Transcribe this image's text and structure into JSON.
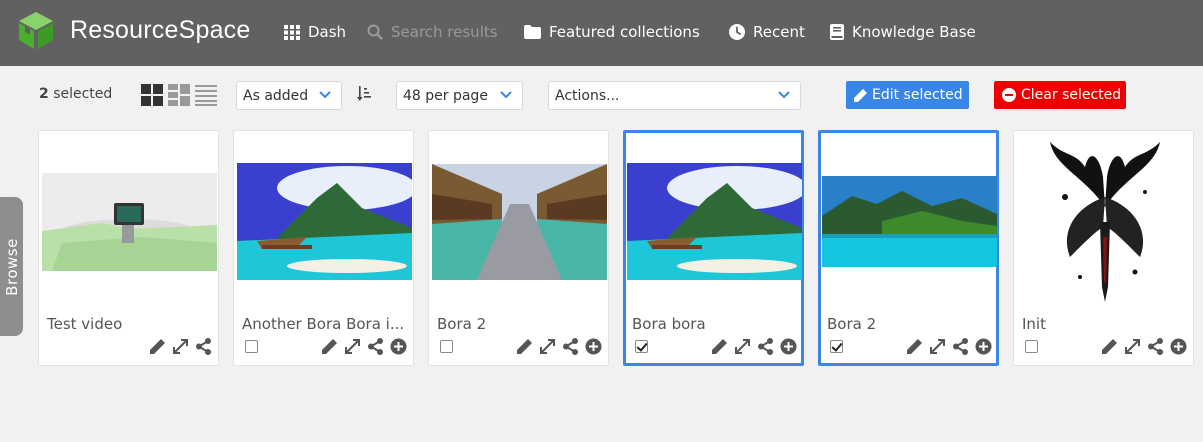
{
  "header": {
    "brand": "ResourceSpace",
    "nav": [
      {
        "label": "Dash",
        "icon": "grid-icon"
      },
      {
        "label": "Search results",
        "icon": "search-icon",
        "disabled": true
      },
      {
        "label": "Featured collections",
        "icon": "folder-icon"
      },
      {
        "label": "Recent",
        "icon": "clock-icon"
      },
      {
        "label": "Knowledge Base",
        "icon": "book-icon"
      }
    ]
  },
  "toolbar": {
    "selected_count": "2",
    "selected_label": "selected",
    "sort_value": "As added",
    "per_page_value": "48 per page",
    "actions_value": "Actions...",
    "edit_selected_label": "Edit selected",
    "clear_selected_label": "Clear selected"
  },
  "browse_label": "Browse",
  "resources": [
    {
      "title": "Test video",
      "selected": false,
      "has_checkbox": false
    },
    {
      "title": "Another Bora Bora i...",
      "selected": false,
      "has_checkbox": true
    },
    {
      "title": "Bora 2",
      "selected": false,
      "has_checkbox": true
    },
    {
      "title": "Bora bora",
      "selected": true,
      "has_checkbox": true
    },
    {
      "title": "Bora 2",
      "selected": true,
      "has_checkbox": true
    },
    {
      "title": "Init",
      "selected": false,
      "has_checkbox": true
    }
  ],
  "colors": {
    "header_bg": "#616161",
    "accent_blue": "#3a86e6",
    "clear_red": "#ee0000",
    "logo_green": "#5fbf3f"
  }
}
